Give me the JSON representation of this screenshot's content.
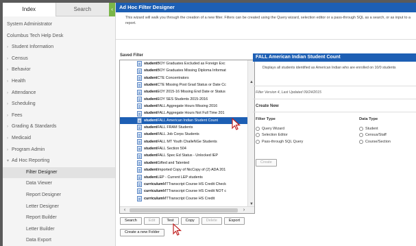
{
  "tabs": {
    "index": "Index",
    "search": "Search",
    "collapse": "‹"
  },
  "nav": {
    "items": [
      {
        "label": "System Administrator",
        "arrow": "",
        "sub": false,
        "active": false
      },
      {
        "label": "Columbus Tech Help Desk",
        "arrow": "",
        "sub": false,
        "active": false
      },
      {
        "label": "Student Information",
        "arrow": "›",
        "sub": false,
        "active": false
      },
      {
        "label": "Census",
        "arrow": "›",
        "sub": false,
        "active": false
      },
      {
        "label": "Behavior",
        "arrow": "›",
        "sub": false,
        "active": false
      },
      {
        "label": "Health",
        "arrow": "›",
        "sub": false,
        "active": false
      },
      {
        "label": "Attendance",
        "arrow": "›",
        "sub": false,
        "active": false
      },
      {
        "label": "Scheduling",
        "arrow": "›",
        "sub": false,
        "active": false
      },
      {
        "label": "Fees",
        "arrow": "›",
        "sub": false,
        "active": false
      },
      {
        "label": "Grading & Standards",
        "arrow": "›",
        "sub": false,
        "active": false
      },
      {
        "label": "Medicaid",
        "arrow": "›",
        "sub": false,
        "active": false
      },
      {
        "label": "Program Admin",
        "arrow": "›",
        "sub": false,
        "active": false
      },
      {
        "label": "Ad Hoc Reporting",
        "arrow": "▾",
        "sub": false,
        "active": false
      },
      {
        "label": "Filter Designer",
        "arrow": "",
        "sub": true,
        "active": true
      },
      {
        "label": "Data Viewer",
        "arrow": "",
        "sub": true,
        "active": false
      },
      {
        "label": "Report Designer",
        "arrow": "",
        "sub": true,
        "active": false
      },
      {
        "label": "Letter Designer",
        "arrow": "",
        "sub": true,
        "active": false
      },
      {
        "label": "Report Builder",
        "arrow": "",
        "sub": true,
        "active": false
      },
      {
        "label": "Letter Builder",
        "arrow": "",
        "sub": true,
        "active": false
      },
      {
        "label": "Data Export",
        "arrow": "",
        "sub": true,
        "active": false
      }
    ]
  },
  "main": {
    "title": "Ad Hoc Filter Designer",
    "intro": "This wizard will walk you through the creation of a new filter. Filters can be created using the Query wizard, selection editor or a pass-through SQL as a search, or as input to a report.",
    "saved_filter_label": "Saved Filter",
    "saved_filters": [
      {
        "type": "student",
        "name": "BOY Graduates Excluded as Foreign Exc",
        "selected": false
      },
      {
        "type": "student",
        "name": "BOY Graduates Missing Diploma Informat",
        "selected": false
      },
      {
        "type": "student",
        "name": "CTE Concentrators",
        "selected": false
      },
      {
        "type": "student",
        "name": "CTE Missing Post Grad Status or Date Cc",
        "selected": false
      },
      {
        "type": "student",
        "name": "EOY 2015-16 Missing End Date or Status",
        "selected": false
      },
      {
        "type": "student",
        "name": "EOY SES Students 2015-2016",
        "selected": false
      },
      {
        "type": "student",
        "name": "FALL Aggregate Hours Missing 2016",
        "selected": false
      },
      {
        "type": "student",
        "name": "FALL Aggregate Hours Not Full Time 201",
        "selected": false
      },
      {
        "type": "student",
        "name": "FALL American Indian Student Count",
        "selected": true
      },
      {
        "type": "student",
        "name": "FALL FRAM Students",
        "selected": false
      },
      {
        "type": "student",
        "name": "FALL Job Corps Students",
        "selected": false
      },
      {
        "type": "student",
        "name": "FALL MT Youth ChalleNGe Students",
        "selected": false
      },
      {
        "type": "student",
        "name": "FALL Section 504",
        "selected": false
      },
      {
        "type": "student",
        "name": "FALL Spec Ed Status - Unlocked IEP",
        "selected": false
      },
      {
        "type": "student",
        "name": "Gifted and Talented",
        "selected": false
      },
      {
        "type": "student",
        "name": "Imported Copy of NicCopy of (2) ADA 201",
        "selected": false
      },
      {
        "type": "student",
        "name": "LEP - Current LEP students",
        "selected": false
      },
      {
        "type": "curriculum",
        "name": "MTTranscript Course HS Credit Check",
        "selected": false
      },
      {
        "type": "curriculum",
        "name": "MTTranscript Course HS Credit NOT c",
        "selected": false
      },
      {
        "type": "curriculum",
        "name": "MTTranscript Course HS Credit",
        "selected": false
      }
    ],
    "buttons": [
      {
        "label": "Search",
        "disabled": false,
        "name": "search-button"
      },
      {
        "label": "Edit",
        "disabled": true,
        "name": "edit-button"
      },
      {
        "label": "Test",
        "disabled": false,
        "name": "test-button"
      },
      {
        "label": "Copy",
        "disabled": false,
        "name": "copy-button"
      },
      {
        "label": "Delete",
        "disabled": true,
        "name": "delete-button"
      },
      {
        "label": "Export",
        "disabled": false,
        "name": "export-button"
      }
    ],
    "new_folder_label": "Create a new Folder"
  },
  "detail": {
    "title": "FALL American Indian Student Count",
    "description": "Displays all students identified as American Indian who are enrolled on 10/0 students",
    "meta": "Filter Version 4,  Last Updated 09/24/2015",
    "create_new": "Create New",
    "filter_type_header": "Filter Type",
    "data_type_header": "Data Type",
    "filter_types": [
      "Query Wizard",
      "Selection Editor",
      "Pass-through SQL Query"
    ],
    "data_types": [
      "Student",
      "Census/Staff",
      "Course/Section"
    ],
    "create_button": "Create"
  },
  "colors": {
    "accent": "#1d5fb4",
    "collapse_tab": "#7ab648"
  }
}
